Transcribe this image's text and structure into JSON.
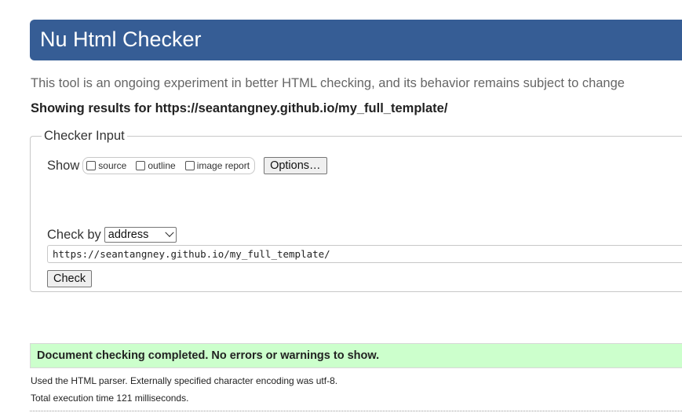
{
  "header": {
    "title": "Nu Html Checker"
  },
  "tagline": "This tool is an ongoing experiment in better HTML checking, and its behavior remains subject to change",
  "results_for": "Showing results for https://seantangney.github.io/my_full_template/",
  "checker_input": {
    "legend": "Checker Input",
    "show_label": "Show",
    "show_options": [
      {
        "label": "source",
        "checked": false
      },
      {
        "label": "outline",
        "checked": false
      },
      {
        "label": "image report",
        "checked": false
      }
    ],
    "options_button": "Options…",
    "check_by_label": "Check by",
    "check_by_value": "address",
    "url_value": "https://seantangney.github.io/my_full_template/",
    "check_button": "Check"
  },
  "result": {
    "message": "Document checking completed. No errors or warnings to show.",
    "parser_note": "Used the HTML parser. Externally specified character encoding was utf-8.",
    "execution_time": "Total execution time 121 milliseconds."
  },
  "colors": {
    "header_bg": "#365d95",
    "success_bg": "#ccffcc"
  }
}
